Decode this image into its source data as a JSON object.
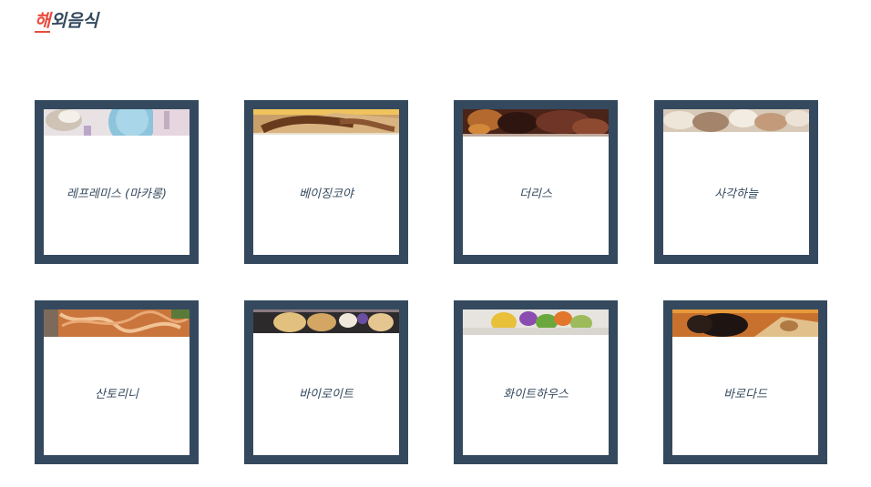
{
  "heading": {
    "accent_char": "해",
    "rest": "외음식"
  },
  "restaurants": [
    {
      "name": "레프레미스 (마카롱)",
      "image": "macarons-photo"
    },
    {
      "name": "베이징코야",
      "image": "grilled-meat-photo"
    },
    {
      "name": "더리스",
      "image": "steak-photo"
    },
    {
      "name": "사각하늘",
      "image": "dumplings-photo"
    },
    {
      "name": "산토리니",
      "image": "pasta-photo"
    },
    {
      "name": "바이로이트",
      "image": "fried-dumplings-photo"
    },
    {
      "name": "화이트하우스",
      "image": "salad-photo"
    },
    {
      "name": "바로다드",
      "image": "flatbread-photo"
    }
  ]
}
